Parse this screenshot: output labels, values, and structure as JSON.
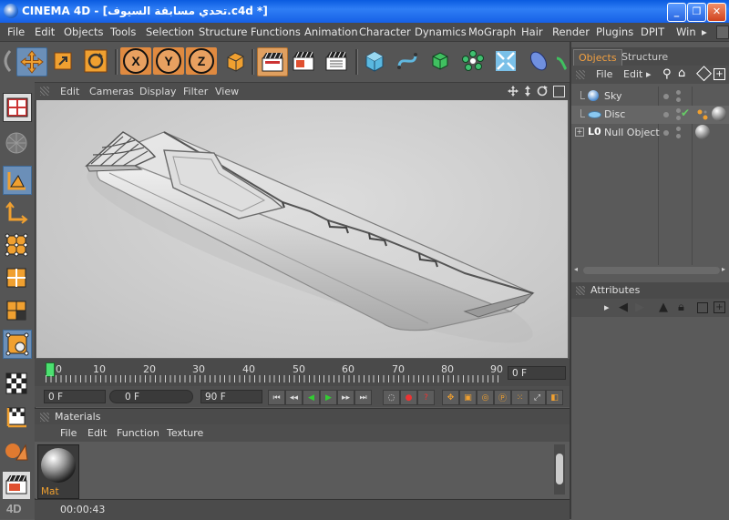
{
  "window": {
    "title": "CINEMA 4D - [تحدي مسابقة السيوف.c4d *]",
    "buttons": [
      "_",
      "❐",
      "✕"
    ]
  },
  "menu": [
    "File",
    "Edit",
    "Objects",
    "Tools",
    "Selection",
    "Structure",
    "Functions",
    "Animation",
    "Character",
    "Dynamics",
    "MoGraph",
    "Hair",
    "Render",
    "Plugins",
    "DPIT",
    "Win"
  ],
  "menu_overflow": "▸",
  "toolbar": {
    "axes": [
      "X",
      "Y",
      "Z"
    ],
    "icons": [
      "undo-icon",
      "move-icon",
      "scale-icon",
      "rotate-icon",
      "axis-x-icon",
      "axis-y-icon",
      "axis-z-icon",
      "coordinate-system-icon",
      "render-view-icon",
      "render-picture-viewer-icon",
      "render-settings-icon",
      "cube-primitive-icon",
      "spline-pen-icon",
      "nurbs-icon",
      "array-icon",
      "deformer-icon",
      "scene-floor-icon"
    ]
  },
  "viewport": {
    "menu": [
      "Edit",
      "Cameras",
      "Display",
      "Filter",
      "View"
    ]
  },
  "timeline": {
    "ticks": [
      "0",
      "10",
      "20",
      "30",
      "40",
      "50",
      "60",
      "70",
      "80",
      "90"
    ],
    "current_frame_field": "0 F",
    "start_field": "0 F",
    "range_field": "0 F",
    "end_field": "90 F"
  },
  "materials": {
    "title": "Materials",
    "menu": [
      "File",
      "Edit",
      "Function",
      "Texture"
    ],
    "items": [
      {
        "label": "Mat"
      }
    ]
  },
  "status": {
    "time": "00:00:43"
  },
  "objects_panel": {
    "tabs": [
      "Objects",
      "Structure"
    ],
    "menu": [
      "File",
      "Edit"
    ],
    "objects": [
      {
        "name": "Sky"
      },
      {
        "name": "Disc"
      },
      {
        "name": "Null Object"
      }
    ]
  },
  "attributes_panel": {
    "title": "Attributes"
  },
  "colors": {
    "accent_orange": "#e8a060",
    "tab_active_text": "#f2a040",
    "titlebar_blue": "#0a5be0"
  }
}
